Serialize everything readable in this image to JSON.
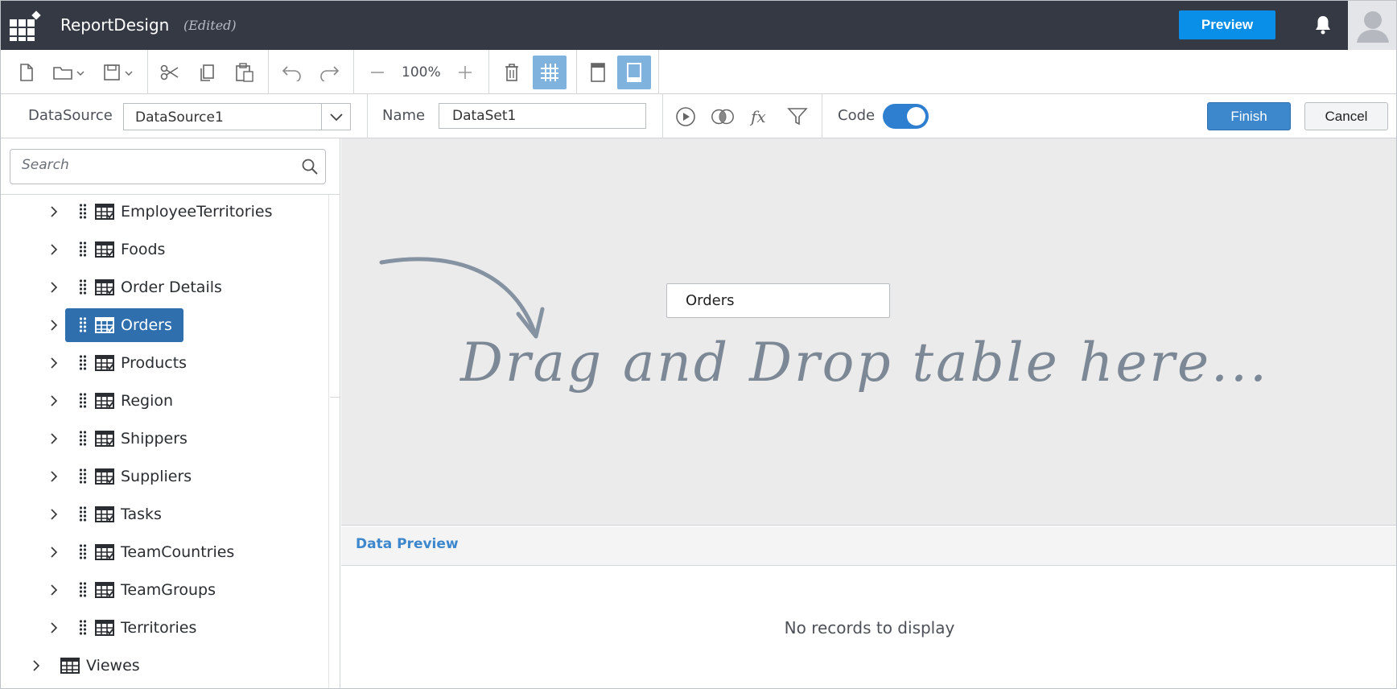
{
  "header": {
    "app_title": "ReportDesign",
    "status": "(Edited)",
    "preview_label": "Preview"
  },
  "toolbar": {
    "zoom": "100%"
  },
  "querybar": {
    "datasource_label": "DataSource",
    "datasource_value": "DataSource1",
    "name_label": "Name",
    "name_value": "DataSet1",
    "code_label": "Code",
    "code_enabled": true,
    "finish_label": "Finish",
    "cancel_label": "Cancel"
  },
  "sidebar": {
    "search_placeholder": "Search",
    "items": [
      {
        "label": "EmployeeTerritories",
        "selected": false
      },
      {
        "label": "Foods",
        "selected": false
      },
      {
        "label": "Order Details",
        "selected": false
      },
      {
        "label": "Orders",
        "selected": true
      },
      {
        "label": "Products",
        "selected": false
      },
      {
        "label": "Region",
        "selected": false
      },
      {
        "label": "Shippers",
        "selected": false
      },
      {
        "label": "Suppliers",
        "selected": false
      },
      {
        "label": "Tasks",
        "selected": false
      },
      {
        "label": "TeamCountries",
        "selected": false
      },
      {
        "label": "TeamGroups",
        "selected": false
      },
      {
        "label": "Territories",
        "selected": false
      }
    ],
    "group": {
      "label": "Viewes"
    }
  },
  "canvas": {
    "table_card": "Orders",
    "drop_hint": "Drag and Drop table here..."
  },
  "preview": {
    "title": "Data Preview",
    "empty_message": "No records to display"
  },
  "colors": {
    "header_bg": "#343944",
    "accent_blue": "#0a8fe8",
    "selected_bg": "#2f6fae",
    "toggle_on": "#2f7fd0"
  }
}
